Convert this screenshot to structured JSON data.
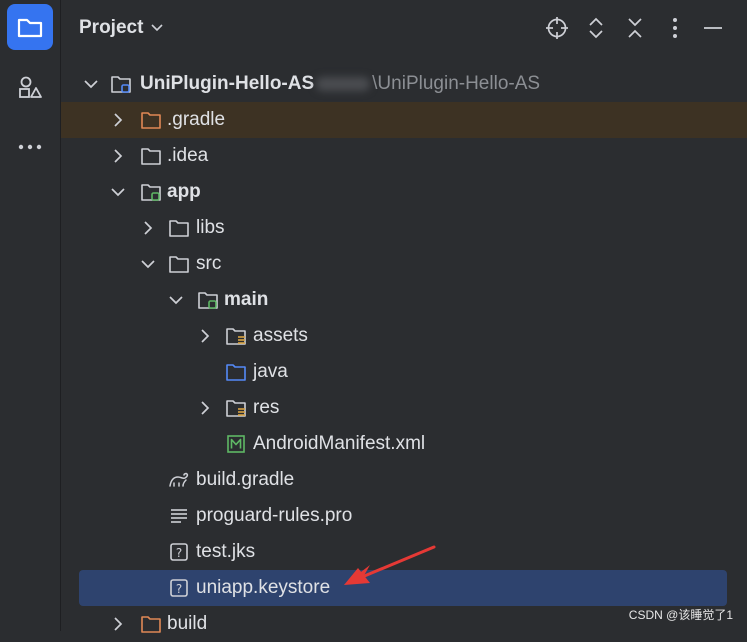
{
  "panel": {
    "title": "Project"
  },
  "project_root": {
    "name": "UniPlugin-Hello-AS",
    "path_suffix": "\\UniPlugin-Hello-AS"
  },
  "tree": {
    "gradle": ".gradle",
    "idea": ".idea",
    "app": "app",
    "libs": "libs",
    "src": "src",
    "main": "main",
    "assets": "assets",
    "java": "java",
    "res": "res",
    "manifest": "AndroidManifest.xml",
    "build_gradle": "build.gradle",
    "proguard": "proguard-rules.pro",
    "test_jks": "test.jks",
    "keystore": "uniapp.keystore",
    "build": "build"
  },
  "icons": {
    "rail_project": "folder-icon",
    "rail_structure": "shapes-icon",
    "rail_more": "more-icon",
    "locate": "crosshair-icon",
    "expand_all": "expand-all-icon",
    "collapse_all": "collapse-all-icon",
    "options": "vertical-dots-icon",
    "hide": "minimize-icon"
  },
  "colors": {
    "accent": "#3574f0",
    "selection": "#2e436e",
    "excluded": "#3d3223",
    "arrow_annotation": "#e53935"
  },
  "watermark": "CSDN @该睡觉了1"
}
